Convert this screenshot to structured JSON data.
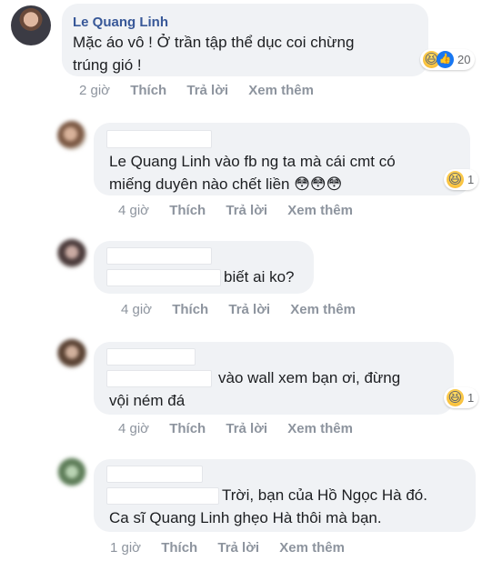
{
  "colors": {
    "author_link": "#385898",
    "bubble_bg": "#f0f2f5",
    "meta_text": "#8d949e",
    "like_blue": "#1877f2",
    "haha_yellow": "#f7b125"
  },
  "main_comment": {
    "author": "Le Quang Linh",
    "text": "Mặc áo vô ! Ở trần tập thể dục coi chừng\ntrúng gió !",
    "reaction_count": "20",
    "time": "2 giờ",
    "like": "Thích",
    "reply": "Trả lời",
    "see_more": "Xem thêm"
  },
  "replies": [
    {
      "text": "Le Quang Linh vào fb ng ta mà cái cmt có\nmiếng duyên nào chết liền 😳😳😳",
      "reaction_count": "1",
      "time": "4 giờ",
      "like": "Thích",
      "reply": "Trả lời",
      "see_more": "Xem thêm"
    },
    {
      "text": "biết ai ko?",
      "time": "4 giờ",
      "like": "Thích",
      "reply": "Trả lời",
      "see_more": "Xem thêm"
    },
    {
      "text_line1": "vào wall xem bạn ơi, đừng",
      "text_line2": "vội ném đá",
      "reaction_count": "1",
      "time": "4 giờ",
      "like": "Thích",
      "reply": "Trả lời",
      "see_more": "Xem thêm"
    },
    {
      "text_line1": "Trời, bạn của Hồ Ngọc Hà đó.",
      "text_line2": "Ca sĩ Quang Linh ghẹo Hà thôi mà bạn.",
      "time": "1 giờ",
      "like": "Thích",
      "reply": "Trả lời",
      "see_more": "Xem thêm"
    }
  ]
}
